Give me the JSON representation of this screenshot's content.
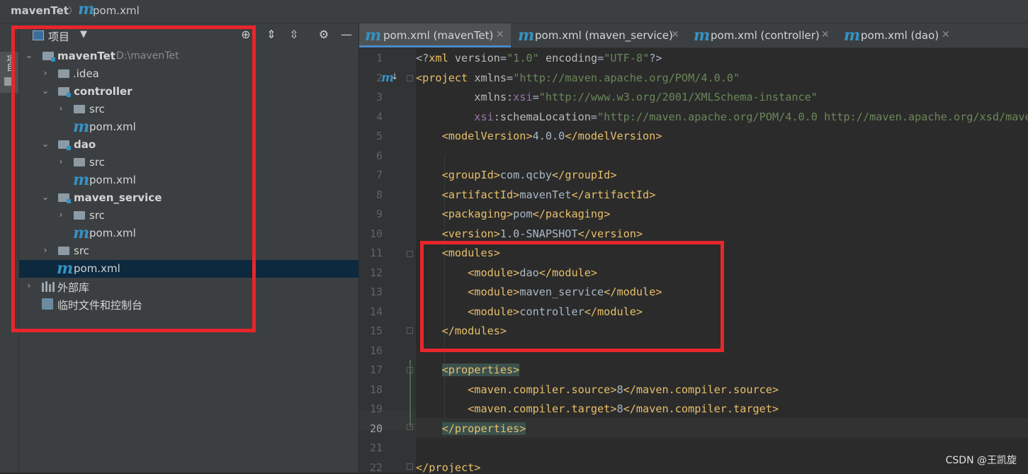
{
  "breadcrumb": {
    "project": "mavenTet",
    "file": "pom.xml"
  },
  "sidestrip": {
    "tab_label": "项目"
  },
  "project_panel": {
    "title": "项目",
    "tree": [
      {
        "label": "mavenTet",
        "path": "D:\\mavenTet"
      },
      {
        "label": ".idea"
      },
      {
        "label": "controller"
      },
      {
        "label": "src"
      },
      {
        "label": "pom.xml"
      },
      {
        "label": "dao"
      },
      {
        "label": "src"
      },
      {
        "label": "pom.xml"
      },
      {
        "label": "maven_service"
      },
      {
        "label": "src"
      },
      {
        "label": "pom.xml"
      },
      {
        "label": "src"
      },
      {
        "label": "pom.xml"
      },
      {
        "label": "外部库"
      },
      {
        "label": "临时文件和控制台"
      }
    ]
  },
  "tabs": [
    {
      "label": "pom.xml (mavenTet)",
      "active": true
    },
    {
      "label": "pom.xml (maven_service)"
    },
    {
      "label": "pom.xml (controller)"
    },
    {
      "label": "pom.xml (dao)"
    }
  ],
  "editor": {
    "current_line": 20,
    "line_numbers": [
      "1",
      "2",
      "3",
      "4",
      "5",
      "6",
      "7",
      "8",
      "9",
      "10",
      "11",
      "12",
      "13",
      "14",
      "15",
      "16",
      "17",
      "18",
      "19",
      "20",
      "21",
      "22"
    ]
  },
  "watermark": "CSDN @王凯旋",
  "colors": {
    "highlight_box": "#e8262b",
    "accent": "#4a88c7",
    "maven_icon": "#3592c4"
  }
}
